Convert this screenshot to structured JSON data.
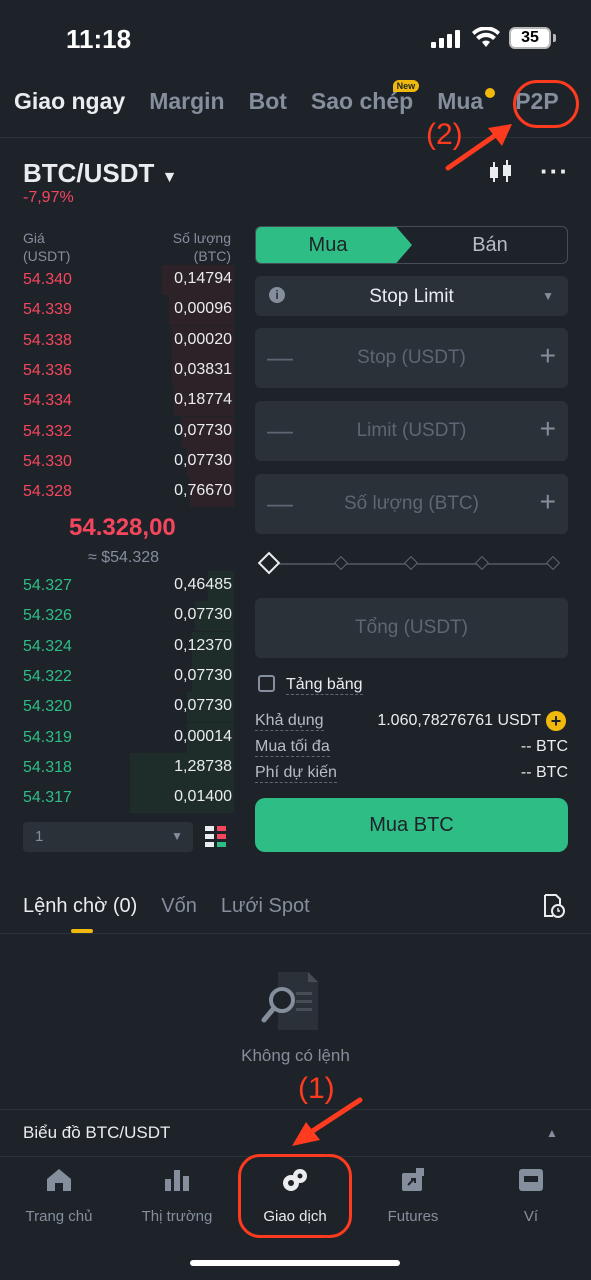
{
  "status_bar": {
    "time": "11:18",
    "battery": "35"
  },
  "top_tabs": [
    {
      "label": "Giao ngay"
    },
    {
      "label": "Margin"
    },
    {
      "label": "Bot"
    },
    {
      "label": "Sao chép",
      "badge": "New"
    },
    {
      "label": "Mua"
    },
    {
      "label": "P2P"
    }
  ],
  "annotations": {
    "label_1": "(1)",
    "label_2": "(2)"
  },
  "pair": {
    "symbol": "BTC/USDT",
    "change": "-7,97%"
  },
  "orderbook": {
    "price_header": "Giá",
    "price_unit": "(USDT)",
    "qty_header": "Số lượng",
    "qty_unit": "(BTC)",
    "asks": [
      {
        "price": "54.340",
        "qty": "0,14794",
        "depth": 0.55
      },
      {
        "price": "54.339",
        "qty": "0,00096",
        "depth": 0.5
      },
      {
        "price": "54.338",
        "qty": "0,00020",
        "depth": 0.48
      },
      {
        "price": "54.336",
        "qty": "0,03831",
        "depth": 0.48
      },
      {
        "price": "54.334",
        "qty": "0,18774",
        "depth": 0.46
      },
      {
        "price": "54.332",
        "qty": "0,07730",
        "depth": 0.4
      },
      {
        "price": "54.330",
        "qty": "0,07730",
        "depth": 0.36
      },
      {
        "price": "54.328",
        "qty": "0,76670",
        "depth": 0.34
      }
    ],
    "mid_price": "54.328,00",
    "mid_usd": "≈ $54.328",
    "bids": [
      {
        "price": "54.327",
        "qty": "0,46485",
        "depth": 0.2
      },
      {
        "price": "54.326",
        "qty": "0,07730",
        "depth": 0.3
      },
      {
        "price": "54.324",
        "qty": "0,12370",
        "depth": 0.32
      },
      {
        "price": "54.322",
        "qty": "0,07730",
        "depth": 0.32
      },
      {
        "price": "54.320",
        "qty": "0,07730",
        "depth": 0.36
      },
      {
        "price": "54.319",
        "qty": "0,00014",
        "depth": 0.36
      },
      {
        "price": "54.318",
        "qty": "1,28738",
        "depth": 0.8
      },
      {
        "price": "54.317",
        "qty": "0,01400",
        "depth": 0.8
      }
    ],
    "depth_select": "1"
  },
  "trade_form": {
    "buy_label": "Mua",
    "sell_label": "Bán",
    "order_type": "Stop Limit",
    "stop_placeholder": "Stop (USDT)",
    "limit_placeholder": "Limit (USDT)",
    "qty_placeholder": "Số lượng (BTC)",
    "total_placeholder": "Tổng (USDT)",
    "iceberg_label": "Tảng băng",
    "available_label": "Khả dụng",
    "available_value": "1.060,78276761 USDT",
    "max_buy_label": "Mua tối đa",
    "max_buy_value": "-- BTC",
    "fee_label": "Phí dự kiến",
    "fee_value": "-- BTC",
    "buy_button": "Mua BTC"
  },
  "orders": {
    "tabs": [
      "Lệnh chờ (0)",
      "Vốn",
      "Lưới Spot"
    ],
    "empty_text": "Không có lệnh",
    "chart_label": "Biểu đồ BTC/USDT"
  },
  "bottom_nav": [
    {
      "label": "Trang chủ",
      "icon": "home-icon"
    },
    {
      "label": "Thị trường",
      "icon": "market-icon"
    },
    {
      "label": "Giao dịch",
      "icon": "trade-icon"
    },
    {
      "label": "Futures",
      "icon": "futures-icon"
    },
    {
      "label": "Ví",
      "icon": "wallet-icon"
    }
  ],
  "colors": {
    "up": "#2ebd85",
    "down": "#f6465d",
    "accent": "#f0b90b",
    "annotation": "#ff3b1f"
  }
}
